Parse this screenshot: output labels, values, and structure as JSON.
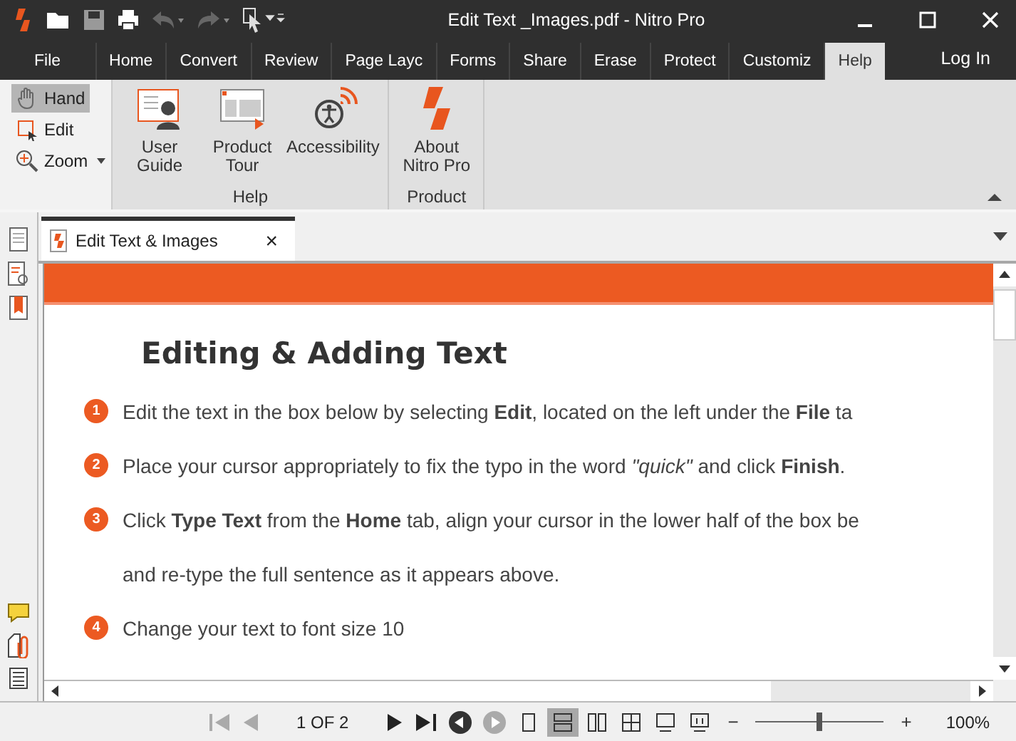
{
  "window": {
    "title": "Edit Text _Images.pdf - Nitro Pro"
  },
  "ribbon_tabs": [
    {
      "label": "File",
      "selected": false
    },
    {
      "label": "Home",
      "selected": false
    },
    {
      "label": "Convert",
      "selected": false
    },
    {
      "label": "Review",
      "selected": false
    },
    {
      "label": "Page Layc",
      "selected": false
    },
    {
      "label": "Forms",
      "selected": false
    },
    {
      "label": "Share",
      "selected": false
    },
    {
      "label": "Erase",
      "selected": false
    },
    {
      "label": "Protect",
      "selected": false
    },
    {
      "label": "Customiz",
      "selected": false
    },
    {
      "label": "Help",
      "selected": true
    }
  ],
  "login": "Log In",
  "tools": [
    {
      "label": "Hand",
      "selected": true,
      "kind": "hand"
    },
    {
      "label": "Edit",
      "selected": false,
      "kind": "edit"
    },
    {
      "label": "Zoom",
      "selected": false,
      "kind": "zoom"
    }
  ],
  "groups": [
    {
      "label": "Help",
      "buttons": [
        {
          "label": "User Guide",
          "kind": "guide"
        },
        {
          "label": "Product Tour",
          "kind": "tour"
        },
        {
          "label": "Accessibility",
          "kind": "access"
        }
      ]
    },
    {
      "label": "Product",
      "buttons": [
        {
          "label": "About Nitro Pro",
          "kind": "about"
        }
      ]
    }
  ],
  "doc_tab": {
    "label": "Edit Text & Images",
    "close": "×"
  },
  "document": {
    "heading": "Editing & Adding Text",
    "steps": [
      {
        "number": "1",
        "lines": [
          "Edit the text in the box below by selecting **Edit**, located on the left under the **File** ta"
        ]
      },
      {
        "number": "2",
        "lines": [
          "Place your cursor appropriately to fix the typo in the word *\"quick\"* and click **Finish**."
        ]
      },
      {
        "number": "3",
        "lines": [
          "Click **Type Text** from the **Home** tab, align your cursor in the lower half of the box be",
          "and re-type the full sentence as it appears above."
        ]
      },
      {
        "number": "4",
        "lines": [
          "Change your text to font size 10"
        ]
      }
    ]
  },
  "status_bar": {
    "page": "1 OF 2",
    "view_modes": [
      {
        "kind": "single",
        "selected": false
      },
      {
        "kind": "continuous",
        "selected": true
      },
      {
        "kind": "facing",
        "selected": false
      },
      {
        "kind": "grid",
        "selected": false
      },
      {
        "kind": "screen",
        "selected": false
      },
      {
        "kind": "present",
        "selected": false
      }
    ],
    "zoom_minus": "−",
    "zoom_plus": "+",
    "zoom": {
      "level": 0.5
    },
    "zoom_reading": "100%"
  }
}
